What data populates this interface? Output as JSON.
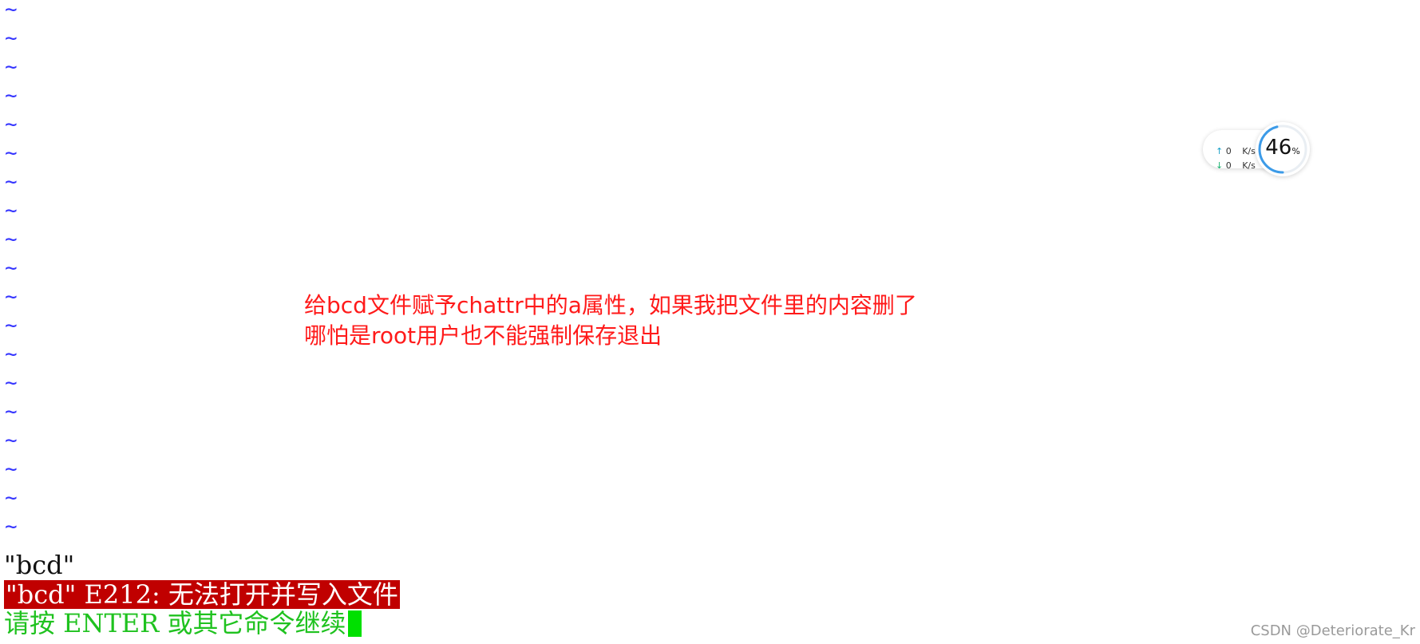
{
  "editor": {
    "tilde_char": "~",
    "empty_line_count": 19,
    "tilde_color": "#3434ff",
    "file_message": "\"bcd\"",
    "error_message": "\"bcd\" E212: 无法打开并写入文件",
    "prompt_message": "请按 ENTER 或其它命令继续"
  },
  "annotation": {
    "line1": "给bcd文件赋予chattr中的a属性，如果我把文件里的内容删了",
    "line2": "哪怕是root用户也不能强制保存退出",
    "color": "#ff1a1a"
  },
  "net_widget": {
    "upload_value": "0",
    "upload_unit": "K/s",
    "download_value": "0",
    "download_unit": "K/s",
    "percent_value": "46",
    "percent_sign": "%",
    "percent_fraction": 0.46,
    "up_arrow_icon": "arrow-up-icon",
    "down_arrow_icon": "arrow-down-icon",
    "ring_color": "#3c9be8"
  },
  "watermark": {
    "text": "CSDN @Deteriorate_Kr"
  }
}
